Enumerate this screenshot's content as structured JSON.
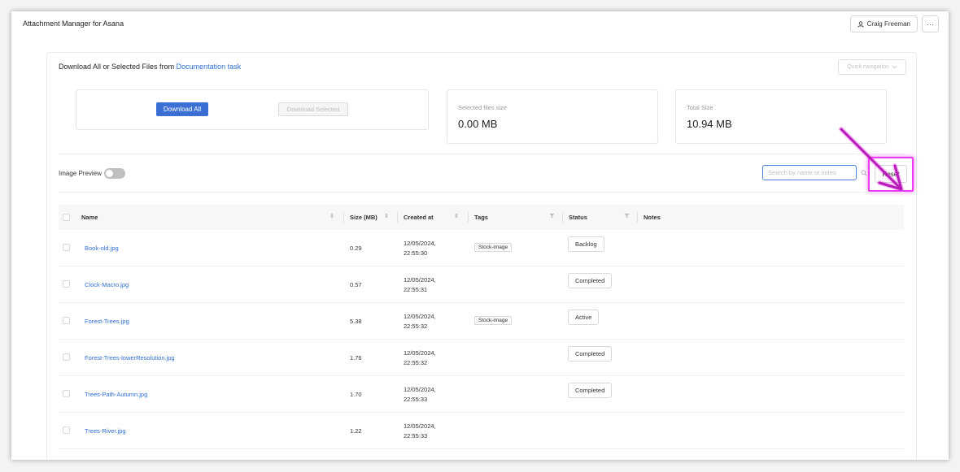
{
  "app": {
    "title": "Attachment Manager for Asana",
    "user_name": "Craig Freeman",
    "more_label": "···"
  },
  "header": {
    "heading_prefix": "Download All or Selected Files from",
    "task_link": "Documentation task",
    "quick_nav": "Quick navigation"
  },
  "actions": {
    "download_all": "Download All",
    "download_selected": "Download Selected"
  },
  "stats": {
    "selected_label": "Selected files size",
    "selected_value": "0.00 MB",
    "total_label": "Total Size",
    "total_value": "10.94 MB"
  },
  "controls": {
    "image_preview_label": "Image Preview",
    "image_preview_on": false,
    "search_placeholder": "Search by name or notes",
    "reset_label": "Reset"
  },
  "table": {
    "columns": [
      "Name",
      "Size (MB)",
      "Created at",
      "Tags",
      "Status",
      "Notes"
    ],
    "rows": [
      {
        "name": "Book-old.jpg",
        "size": "0.29",
        "created_date": "12/05/2024,",
        "created_time": "22:55:30",
        "tag": "Stock-image",
        "status": "Backlog"
      },
      {
        "name": "Clock-Macro.jpg",
        "size": "0.57",
        "created_date": "12/05/2024,",
        "created_time": "22:55:31",
        "tag": "",
        "status": "Completed"
      },
      {
        "name": "Forest-Trees.jpg",
        "size": "5.38",
        "created_date": "12/05/2024,",
        "created_time": "22:55:32",
        "tag": "Stock-image",
        "status": "Active"
      },
      {
        "name": "Forest-Trees-lowerResolution.jpg",
        "size": "1.76",
        "created_date": "12/05/2024,",
        "created_time": "22:55:32",
        "tag": "",
        "status": "Completed"
      },
      {
        "name": "Trees-Path-Autumn.jpg",
        "size": "1.70",
        "created_date": "12/05/2024,",
        "created_time": "22:55:33",
        "tag": "",
        "status": "Completed"
      },
      {
        "name": "Trees-River.jpg",
        "size": "1.22",
        "created_date": "12/05/2024,",
        "created_time": "22:55:33",
        "tag": "",
        "status": ""
      }
    ]
  },
  "colors": {
    "primary": "#3b6fd4",
    "link": "#2f6fd6",
    "highlight": "#ea3cf0"
  }
}
